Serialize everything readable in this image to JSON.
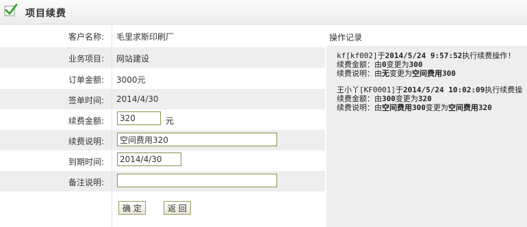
{
  "header": {
    "title": "项目续费",
    "icon": "check-icon",
    "icon_color": "#3aa335"
  },
  "form": {
    "customer_label": "客户名称:",
    "customer_value": "毛里求斯印刷厂",
    "project_label": "业务项目:",
    "project_value": "网站建设",
    "order_amount_label": "订单金额:",
    "order_amount_value": "3000元",
    "sign_date_label": "签单时间:",
    "sign_date_value": "2014/4/30",
    "renew_amount_label": "续费金额:",
    "renew_amount_value": "320",
    "renew_amount_unit": "元",
    "renew_desc_label": "续费说明:",
    "renew_desc_value": "空间费用320",
    "expire_label": "到期时间:",
    "expire_value": "2014/4/30",
    "remark_label": "备注说明:",
    "remark_value": "",
    "confirm_label": "确 定",
    "back_label": "返 回"
  },
  "log": {
    "title": "操作记录",
    "entries": [
      {
        "operator": "kf[kf002]于",
        "time": "2014/5/24 9:57:52",
        "action": "执行续费操作!",
        "amount_prefix": "续费金额：由",
        "amount_from": "0",
        "amount_mid": "变更为",
        "amount_to": "300",
        "desc_prefix": "续费说明：由",
        "desc_from": "无",
        "desc_mid": "变更为",
        "desc_to": "空间费用300"
      },
      {
        "operator": "王小丫[KF0001]于",
        "time": "2014/5/24 10:02:09",
        "action": "执行续费操",
        "amount_prefix": "续费金额：由",
        "amount_from": "300",
        "amount_mid": "变更为",
        "amount_to": "320",
        "desc_prefix": "续费说明：由",
        "desc_from": "空间费用300",
        "desc_mid": "变更为",
        "desc_to": "空间费用320"
      }
    ]
  }
}
